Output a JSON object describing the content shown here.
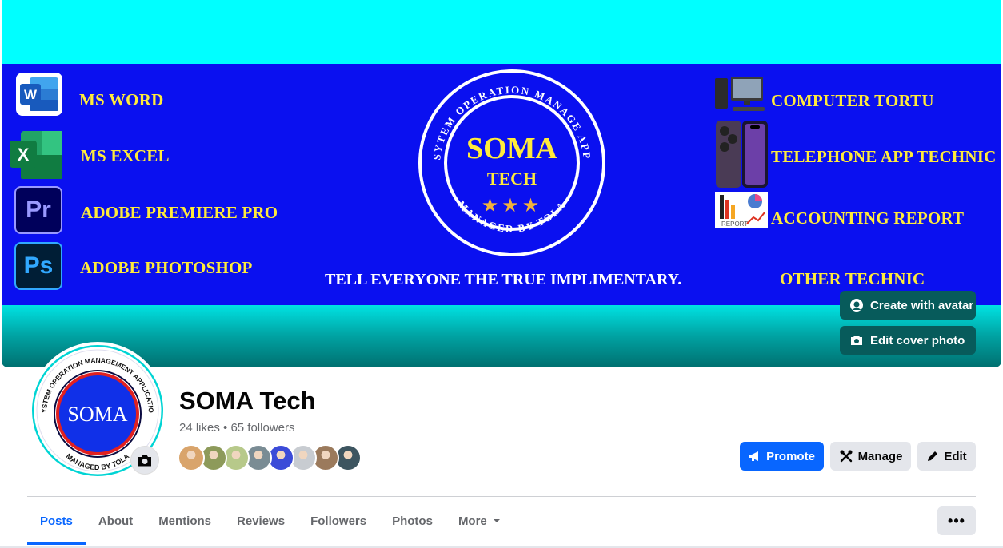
{
  "cover": {
    "left_items": [
      {
        "label": "MS WORD",
        "icon": "word-icon"
      },
      {
        "label": "MS EXCEL",
        "icon": "excel-icon"
      },
      {
        "label": "ADOBE PREMIERE PRO",
        "icon": "premiere-icon"
      },
      {
        "label": "ADOBE PHOTOSHOP",
        "icon": "photoshop-icon"
      }
    ],
    "right_items": [
      {
        "label": "COMPUTER TORTU",
        "icon": "computer-icon"
      },
      {
        "label": "TELEPHONE APP TECHNIC",
        "icon": "phone-icon"
      },
      {
        "label": "ACCOUNTING REPORT",
        "icon": "report-icon"
      }
    ],
    "other_label": "OTHER TECHNIC",
    "tagline": "TELL EVERYONE THE TRUE IMPLIMENTARY.",
    "logo": {
      "ring_text_top": "SYTEM OPERATION MANAGE APP",
      "ring_text_bottom": "MANAGED BY TOLA",
      "title": "SOMA",
      "subtitle": "TECH",
      "stars": "★★★"
    },
    "create_avatar_label": "Create with avatar",
    "edit_cover_label": "Edit cover photo"
  },
  "profile": {
    "avatar_logo": {
      "ring_text_top": "SYSTEM OPERATION MANAGEMENT APPLICATION",
      "ring_text_bottom": "MANAGED BY TOLA",
      "title": "SOMA"
    },
    "name": "SOMA Tech",
    "stats": "24 likes • 65 followers",
    "follower_faces": [
      "#d9a46b",
      "#8d9a5a",
      "#b7c98a",
      "#7a8c94",
      "#3b4bd8",
      "#c8ccd1",
      "#9b7a5c",
      "#3d5560"
    ]
  },
  "actions": {
    "promote": "Promote",
    "manage": "Manage",
    "edit": "Edit"
  },
  "tabs": [
    "Posts",
    "About",
    "Mentions",
    "Reviews",
    "Followers",
    "Photos",
    "More"
  ],
  "more_menu": "•••",
  "colors": {
    "accent": "#0866ff",
    "banner_blue": "#0a10f0",
    "banner_text_yellow": "#ffeb3b",
    "cover_cyan": "#00ffff"
  }
}
